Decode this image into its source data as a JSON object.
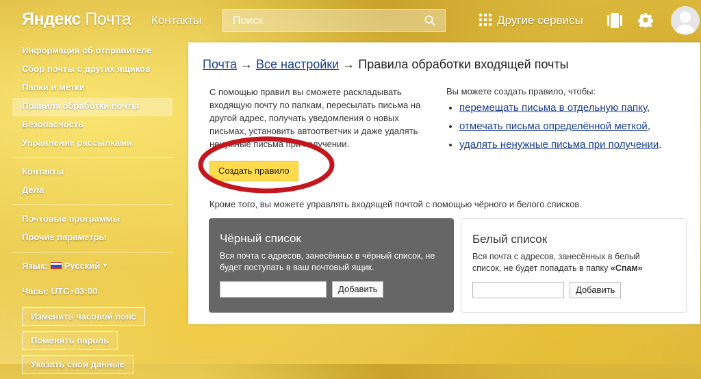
{
  "header": {
    "logo_brand": "Яндекс",
    "logo_product": "Почта",
    "contacts": "Контакты",
    "search_placeholder": "Поиск",
    "services": "Другие сервисы"
  },
  "sidebar": {
    "group1": [
      {
        "label": "Информация об отправителе"
      },
      {
        "label": "Сбор почты с других ящиков"
      },
      {
        "label": "Папки и метки"
      },
      {
        "label": "Правила обработки почты"
      },
      {
        "label": "Безопасность"
      },
      {
        "label": "Управление рассылками"
      }
    ],
    "group2": [
      {
        "label": "Контакты"
      },
      {
        "label": "Дела"
      }
    ],
    "group3": [
      {
        "label": "Почтовые программы"
      },
      {
        "label": "Прочие параметры"
      }
    ],
    "language_label": "Язык:",
    "language_value": "Русский",
    "clock": "Часы: UTC+03:00",
    "btn_timezone": "Изменить часовой пояс",
    "btn_password": "Поменять пароль",
    "btn_data": "Указать свои данные"
  },
  "main": {
    "crumb_mail": "Почта",
    "crumb_all": "Все настройки",
    "crumb_current": "Правила обработки входящей почты",
    "arrow": "→",
    "intro": "С помощью правил вы сможете раскладывать входящую почту по папкам, пересылать письма на другой адрес, получать уведомления о новых письмах, установить автоответчик и даже удалять ненужные письма при получении.",
    "create_button": "Создать правило",
    "right_title": "Вы можете создать правило, чтобы:",
    "rule_links": [
      {
        "text": "перемещать письма в отдельную папку",
        "tail": ","
      },
      {
        "text": "отмечать письма определённой меткой",
        "tail": ","
      },
      {
        "text": "удалять ненужные письма при получении",
        "tail": "."
      }
    ],
    "also": "Кроме того, вы можете управлять входящей почтой с помощью чёрного и белого списков.",
    "blacklist": {
      "title": "Чёрный список",
      "desc": "Вся почта с адресов, занесённых в чёрный список, не будет поступать в ваш почтовый ящик.",
      "add": "Добавить"
    },
    "whitelist": {
      "title": "Белый список",
      "desc": "Вся почта с адресов, занесённых в белый список, не будет попадать в папку ",
      "desc_bold": "«Спам»",
      "add": "Добавить"
    }
  },
  "colors": {
    "accent_button": "#ffdb4d",
    "link": "#1a3d8c",
    "highlight_ring": "#c4161c"
  }
}
